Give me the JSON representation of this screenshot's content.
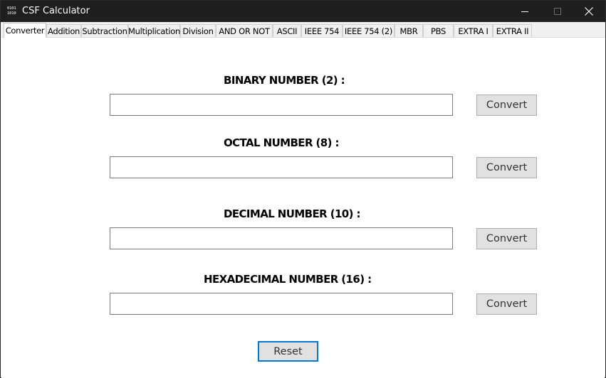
{
  "window": {
    "title": "CSF Calculator",
    "icon_text": "0101 1010",
    "controls": {
      "minimize": "—",
      "maximize": "☐",
      "close": "✕"
    }
  },
  "tabs": [
    {
      "label": "Converter",
      "active": true
    },
    {
      "label": "Addition"
    },
    {
      "label": "Subtraction"
    },
    {
      "label": "Multiplication"
    },
    {
      "label": "Division"
    },
    {
      "label": "AND OR NOT"
    },
    {
      "label": "ASCII"
    },
    {
      "label": "IEEE 754"
    },
    {
      "label": "IEEE 754 (2)"
    },
    {
      "label": "MBR"
    },
    {
      "label": "PBS"
    },
    {
      "label": "EXTRA I"
    },
    {
      "label": "EXTRA II"
    }
  ],
  "converter": {
    "binary": {
      "label": "BINARY NUMBER  (2) :",
      "value": "",
      "button": "Convert"
    },
    "octal": {
      "label": "OCTAL NUMBER  (8) :",
      "value": "",
      "button": "Convert"
    },
    "decimal": {
      "label": "DECIMAL NUMBER  (10) :",
      "value": "",
      "button": "Convert"
    },
    "hex": {
      "label": "HEXADECIMAL NUMBER  (16) :",
      "value": "",
      "button": "Convert"
    },
    "reset": "Reset"
  },
  "colors": {
    "titlebar": "#1f1f1f",
    "focus_border": "#0078d7",
    "button_bg": "#e1e1e1"
  }
}
